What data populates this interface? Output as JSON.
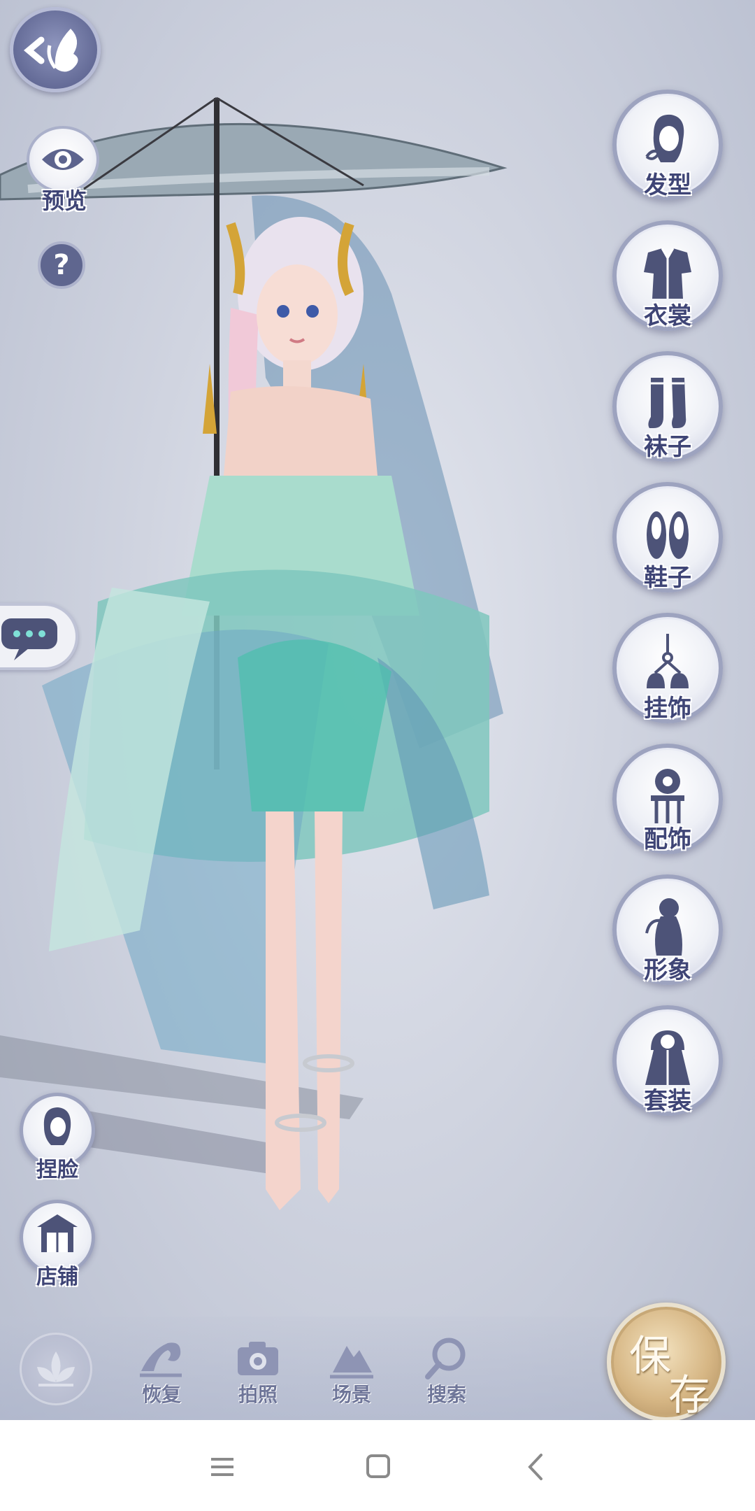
{
  "top_left": {
    "back_icon": "butterfly-back-icon",
    "preview_label": "预览",
    "help_glyph": "?"
  },
  "right_menu": [
    {
      "label": "发型",
      "icon": "hairstyle-icon"
    },
    {
      "label": "衣裳",
      "icon": "clothing-icon"
    },
    {
      "label": "袜子",
      "icon": "socks-icon"
    },
    {
      "label": "鞋子",
      "icon": "shoes-icon"
    },
    {
      "label": "挂饰",
      "icon": "pendant-icon"
    },
    {
      "label": "配饰",
      "icon": "accessory-icon"
    },
    {
      "label": "形象",
      "icon": "appearance-icon"
    },
    {
      "label": "套装",
      "icon": "outfit-set-icon"
    }
  ],
  "left_menu": [
    {
      "label": "捏脸",
      "icon": "face-edit-icon"
    },
    {
      "label": "店铺",
      "icon": "shop-icon"
    }
  ],
  "bottom_bar": [
    {
      "label": "恢复",
      "icon": "wave-restore-icon"
    },
    {
      "label": "拍照",
      "icon": "camera-icon"
    },
    {
      "label": "场景",
      "icon": "scene-mountain-icon"
    },
    {
      "label": "搜索",
      "icon": "search-icon"
    }
  ],
  "save": {
    "char1": "保",
    "char2": "存"
  },
  "colors": {
    "label_text": "#3f4576",
    "button_border": "#9da3bf",
    "save_gold": "#d6b684"
  }
}
